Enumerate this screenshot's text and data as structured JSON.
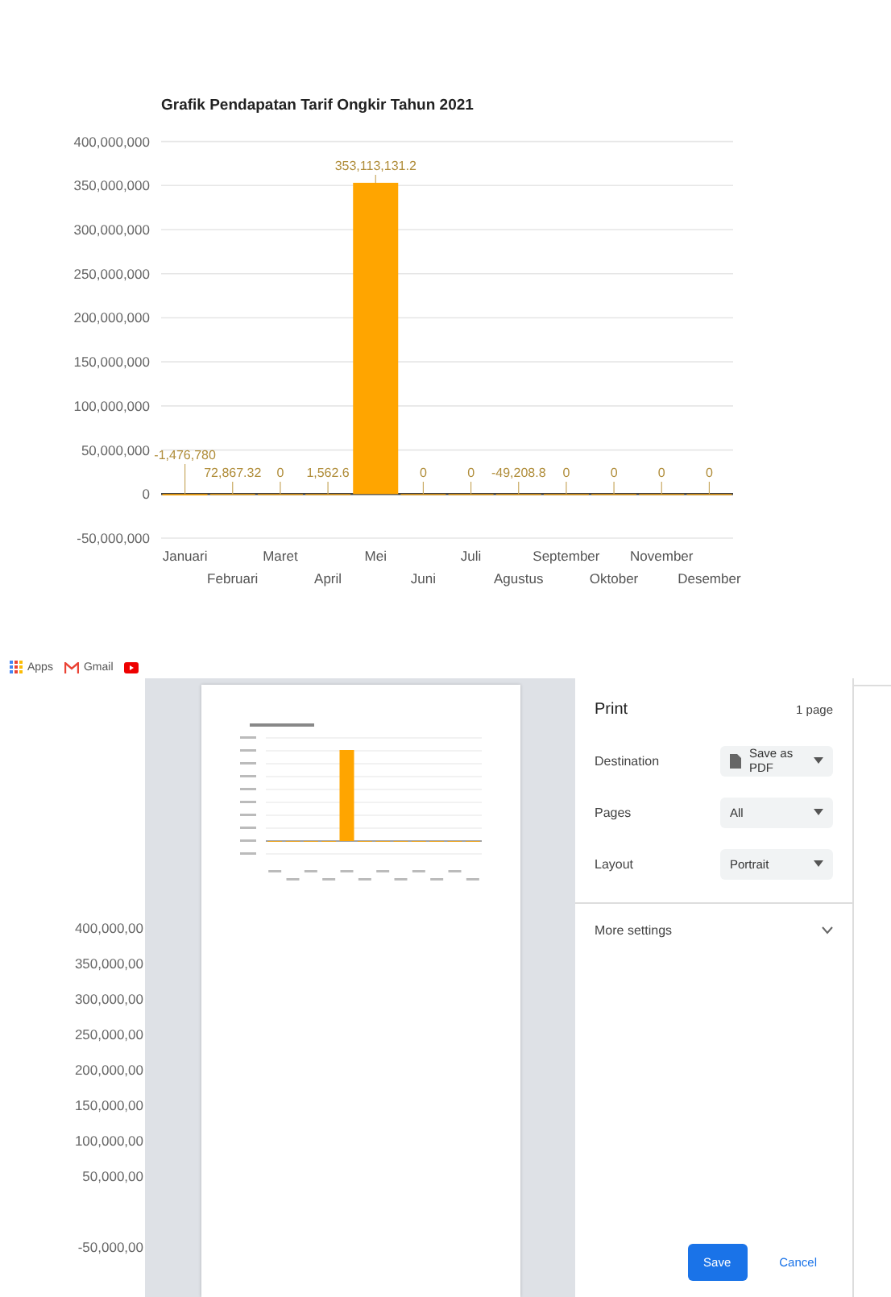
{
  "chart": {
    "chart_data": {
      "type": "bar",
      "title": "Grafik Pendapatan Tarif Ongkir Tahun 2021",
      "categories": [
        "Januari",
        "Februari",
        "Maret",
        "April",
        "Mei",
        "Juni",
        "Juli",
        "Agustus",
        "September",
        "Oktober",
        "November",
        "Desember"
      ],
      "values": [
        -1476780,
        72867.32,
        0,
        1562.6,
        353113131.2,
        0,
        0,
        -49208.8,
        0,
        0,
        0,
        0
      ],
      "grid": true,
      "value_labels": [
        "-1,476,780",
        "72,867.32",
        "0",
        "1,562.6",
        "353,113,131.2",
        "0",
        "0",
        "-49,208.8",
        "0",
        "0",
        "0",
        "0"
      ],
      "ylim": [
        -50000000,
        400000000
      ],
      "yticks": [
        {
          "value": 400000000,
          "label": "400,000,000"
        },
        {
          "value": 350000000,
          "label": "350,000,000"
        },
        {
          "value": 300000000,
          "label": "300,000,000"
        },
        {
          "value": 250000000,
          "label": "250,000,000"
        },
        {
          "value": 200000000,
          "label": "200,000,000"
        },
        {
          "value": 150000000,
          "label": "150,000,000"
        },
        {
          "value": 100000000,
          "label": "100,000,000"
        },
        {
          "value": 50000000,
          "label": "50,000,000"
        },
        {
          "value": 0,
          "label": "0"
        },
        {
          "value": -50000000,
          "label": "-50,000,000"
        }
      ]
    }
  },
  "bookmarks": [
    {
      "kind": "apps",
      "label": "Apps"
    },
    {
      "kind": "gmail",
      "label": "Gmail"
    },
    {
      "kind": "youtube"
    }
  ],
  "background_axis_labels": [
    "400,000,00",
    "350,000,00",
    "300,000,00",
    "250,000,00",
    "200,000,00",
    "150,000,00",
    "100,000,00",
    "50,000,00",
    "-50,000,00"
  ],
  "print_panel": {
    "title": "Print",
    "page_count": "1 page",
    "settings": [
      {
        "label": "Destination",
        "value": "Save as PDF"
      },
      {
        "label": "Pages",
        "value": "All"
      },
      {
        "label": "Layout",
        "value": "Portrait"
      }
    ],
    "more_settings": "More settings",
    "expanded": false,
    "buttons": [
      {
        "label": "Save",
        "kind": "primary"
      },
      {
        "label": "Cancel",
        "kind": "secondary"
      }
    ]
  }
}
